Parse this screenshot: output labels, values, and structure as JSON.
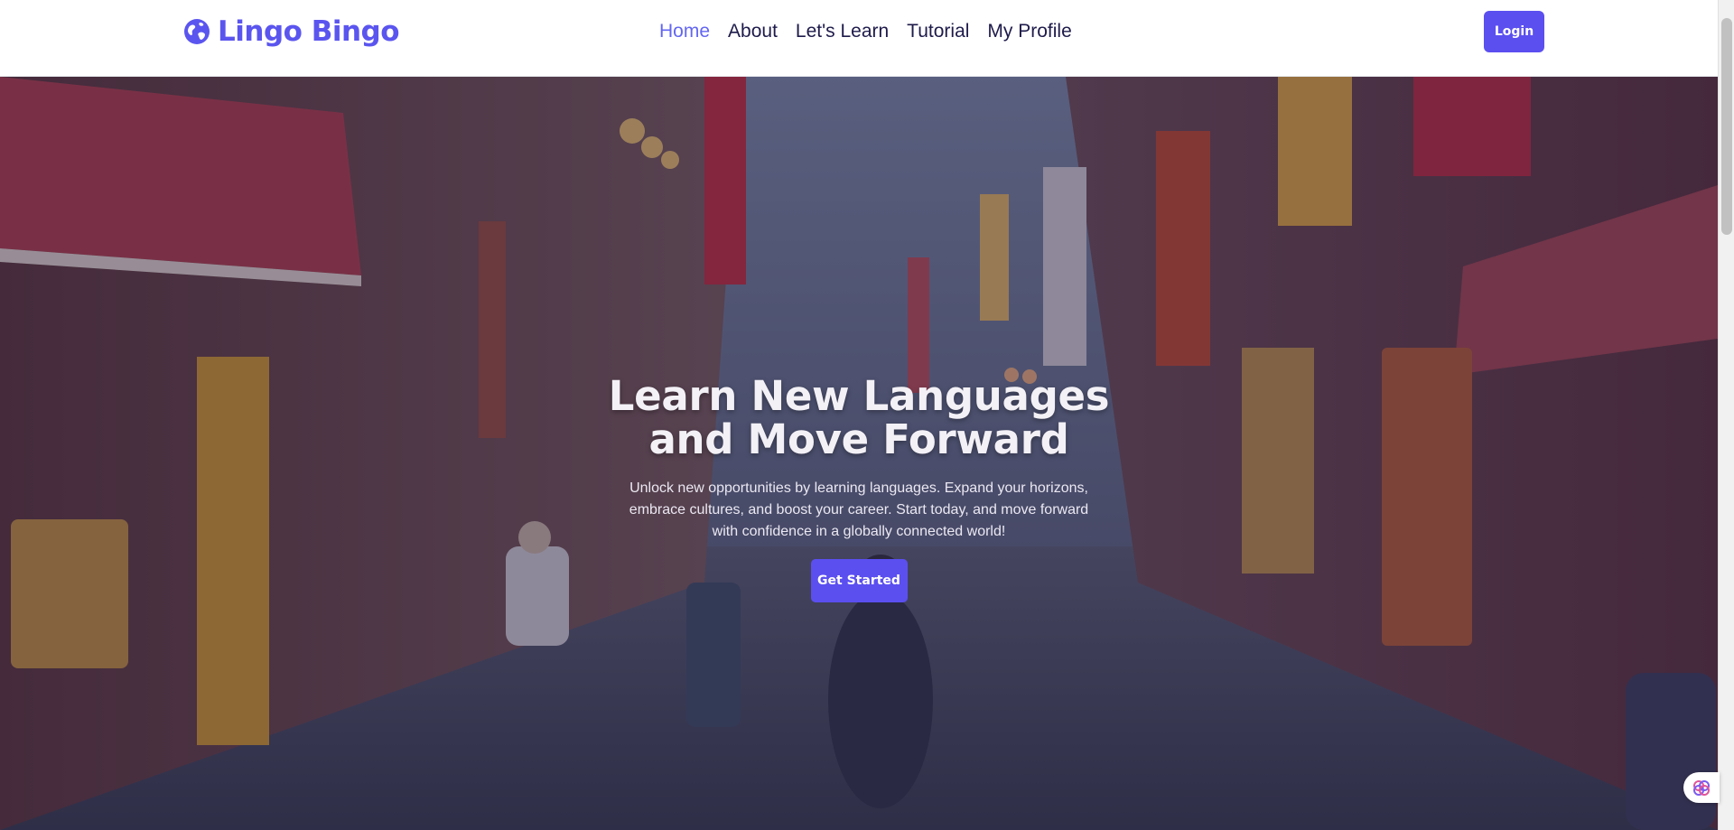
{
  "brand": {
    "name": "Lingo Bingo",
    "icon": "globe-icon",
    "color": "#5b55ef"
  },
  "nav": {
    "links": [
      {
        "label": "Home",
        "active": true
      },
      {
        "label": "About",
        "active": false
      },
      {
        "label": "Let's Learn",
        "active": false
      },
      {
        "label": "Tutorial",
        "active": false
      },
      {
        "label": "My Profile",
        "active": false
      }
    ],
    "active_color": "#6366f1",
    "login_label": "Login"
  },
  "hero": {
    "title_line1": "Learn New Languages",
    "title_line2": "and Move Forward",
    "description": "Unlock new opportunities by learning languages. Expand your horizons, embrace cultures, and boost your career. Start today, and move forward with confidence in a globally connected world!",
    "cta_label": "Get Started",
    "background": "japanese-street-photo"
  },
  "theme": {
    "accent": "#5b4ff0"
  },
  "widget": {
    "icon": "brain-icon"
  }
}
